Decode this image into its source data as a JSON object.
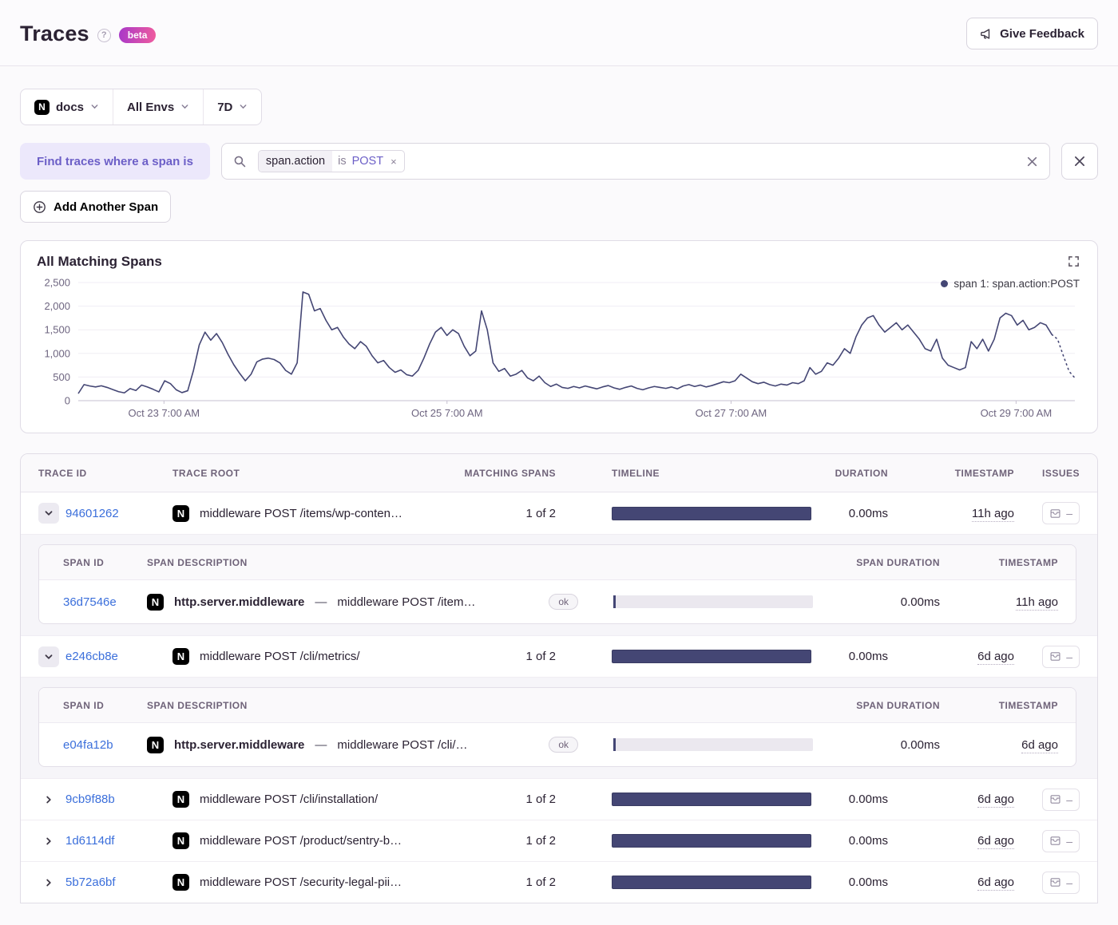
{
  "header": {
    "title": "Traces",
    "beta_label": "beta",
    "feedback_label": "Give Feedback"
  },
  "filters": {
    "project": "docs",
    "environment": "All Envs",
    "date_range": "7D"
  },
  "span_filter": {
    "prefix_label": "Find traces where a span is",
    "token": {
      "key": "span.action",
      "operator": "is",
      "value": "POST",
      "remove_glyph": "×"
    },
    "add_button_label": "Add Another Span"
  },
  "chart_data": {
    "type": "line",
    "title": "All Matching Spans",
    "legend_label": "span 1: span.action:POST",
    "line_color": "#444674",
    "grid_color": "#F0EDF4",
    "axis_color": "#C6C0D0",
    "ylim": [
      0,
      2500
    ],
    "y_ticks": [
      0,
      500,
      1000,
      1500,
      2000,
      2500
    ],
    "y_tick_labels": [
      "0",
      "500",
      "1,000",
      "1,500",
      "2,000",
      "2,500"
    ],
    "x_tick_labels": [
      "Oct 23 7:00 AM",
      "Oct 25 7:00 AM",
      "Oct 27 7:00 AM",
      "Oct 29 7:00 AM"
    ],
    "x_tick_positions": [
      0.086,
      0.37,
      0.655,
      0.941
    ],
    "values": [
      150,
      340,
      310,
      290,
      315,
      280,
      235,
      190,
      165,
      255,
      215,
      330,
      290,
      240,
      185,
      420,
      360,
      230,
      170,
      210,
      640,
      1180,
      1450,
      1280,
      1420,
      1230,
      980,
      760,
      580,
      420,
      560,
      820,
      880,
      900,
      870,
      800,
      640,
      560,
      800,
      2300,
      2250,
      1900,
      1950,
      1700,
      1500,
      1550,
      1350,
      1200,
      1100,
      1250,
      1150,
      950,
      800,
      850,
      700,
      600,
      650,
      550,
      520,
      640,
      900,
      1200,
      1450,
      1550,
      1380,
      1500,
      1420,
      1150,
      950,
      1050,
      1900,
      1500,
      800,
      620,
      680,
      520,
      560,
      640,
      480,
      420,
      520,
      380,
      300,
      350,
      280,
      260,
      300,
      270,
      310,
      280,
      250,
      290,
      320,
      270,
      240,
      280,
      310,
      260,
      230,
      270,
      300,
      280,
      260,
      290,
      250,
      310,
      340,
      300,
      330,
      290,
      320,
      360,
      400,
      380,
      420,
      560,
      480,
      400,
      360,
      390,
      340,
      310,
      350,
      330,
      380,
      360,
      420,
      700,
      560,
      620,
      800,
      750,
      900,
      1100,
      1000,
      1350,
      1600,
      1750,
      1800,
      1600,
      1450,
      1550,
      1650,
      1500,
      1600,
      1450,
      1300,
      1100,
      1050,
      1300,
      900,
      750,
      700,
      650,
      700,
      1250,
      1100,
      1300,
      1050,
      1300,
      1750,
      1850,
      1800,
      1600,
      1700,
      1500,
      1550,
      1650,
      1600,
      1400
    ],
    "tail_values": [
      1300,
      950,
      620,
      480
    ]
  },
  "table": {
    "columns": [
      "Trace ID",
      "Trace Root",
      "Matching Spans",
      "Timeline",
      "Duration",
      "Timestamp",
      "Issues"
    ],
    "span_columns": [
      "Span ID",
      "Span Description",
      "",
      "Span Duration",
      "Timestamp"
    ],
    "span_separator": "—",
    "rows": [
      {
        "id": "94601262",
        "expanded": true,
        "root": "middleware POST /items/wp-conten…",
        "matching": "1 of 2",
        "duration": "0.00ms",
        "timestamp": "11h ago",
        "spans": [
          {
            "id": "36d7546e",
            "op": "http.server.middleware",
            "desc": "middleware POST /item…",
            "status": "ok",
            "duration": "0.00ms",
            "timestamp": "11h ago"
          }
        ]
      },
      {
        "id": "e246cb8e",
        "expanded": true,
        "root": "middleware POST /cli/metrics/",
        "matching": "1 of 2",
        "duration": "0.00ms",
        "timestamp": "6d ago",
        "spans": [
          {
            "id": "e04fa12b",
            "op": "http.server.middleware",
            "desc": "middleware POST /cli/…",
            "status": "ok",
            "duration": "0.00ms",
            "timestamp": "6d ago"
          }
        ]
      },
      {
        "id": "9cb9f88b",
        "expanded": false,
        "root": "middleware POST /cli/installation/",
        "matching": "1 of 2",
        "duration": "0.00ms",
        "timestamp": "6d ago"
      },
      {
        "id": "1d6114df",
        "expanded": false,
        "root": "middleware POST /product/sentry-b…",
        "matching": "1 of 2",
        "duration": "0.00ms",
        "timestamp": "6d ago"
      },
      {
        "id": "5b72a6bf",
        "expanded": false,
        "root": "middleware POST /security-legal-pii…",
        "matching": "1 of 2",
        "duration": "0.00ms",
        "timestamp": "6d ago"
      }
    ]
  }
}
